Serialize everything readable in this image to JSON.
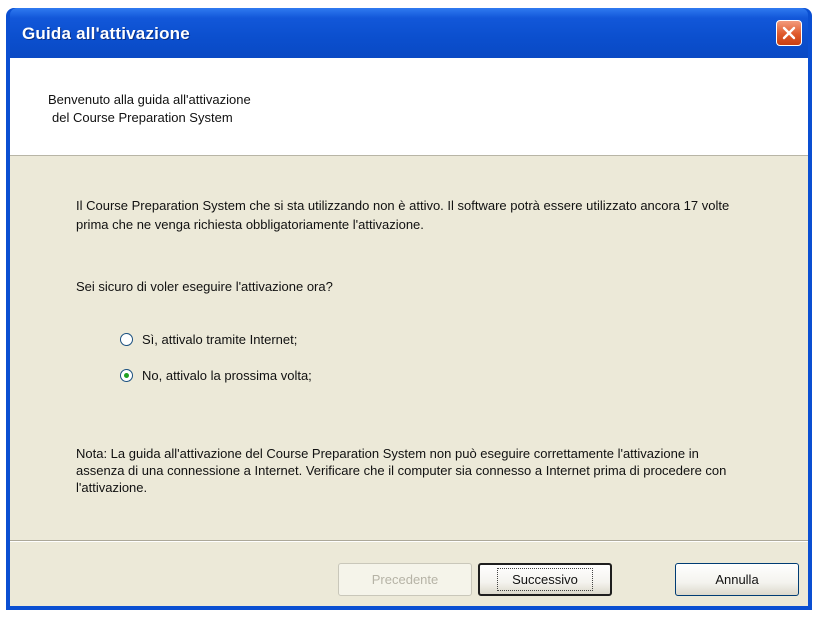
{
  "window": {
    "title": "Guida all'attivazione"
  },
  "header": {
    "line1": "Benvenuto alla guida all'attivazione",
    "line2": "del Course Preparation System"
  },
  "body": {
    "intro": "Il Course Preparation System che si sta utilizzando non è attivo. Il software potrà essere utilizzato ancora 17 volte prima che ne venga richiesta obbligatoriamente l'attivazione.",
    "question": "Sei sicuro di voler eseguire l'attivazione ora?",
    "options": [
      {
        "label": "Sì, attivalo tramite Internet;",
        "selected": false
      },
      {
        "label": "No, attivalo la prossima volta;",
        "selected": true
      }
    ],
    "note": "Nota: La guida all'attivazione del Course Preparation System non può eseguire correttamente l'attivazione in assenza di una connessione a Internet. Verificare che il computer sia connesso a Internet prima di procedere con l'attivazione."
  },
  "buttons": {
    "previous": "Precedente",
    "next": "Successivo",
    "cancel": "Annulla"
  },
  "colors": {
    "titlebar": "#0a4fd2",
    "dialog_bg": "#ece9d8",
    "close_button": "#df5a2c",
    "radio_dot": "#21a121"
  }
}
